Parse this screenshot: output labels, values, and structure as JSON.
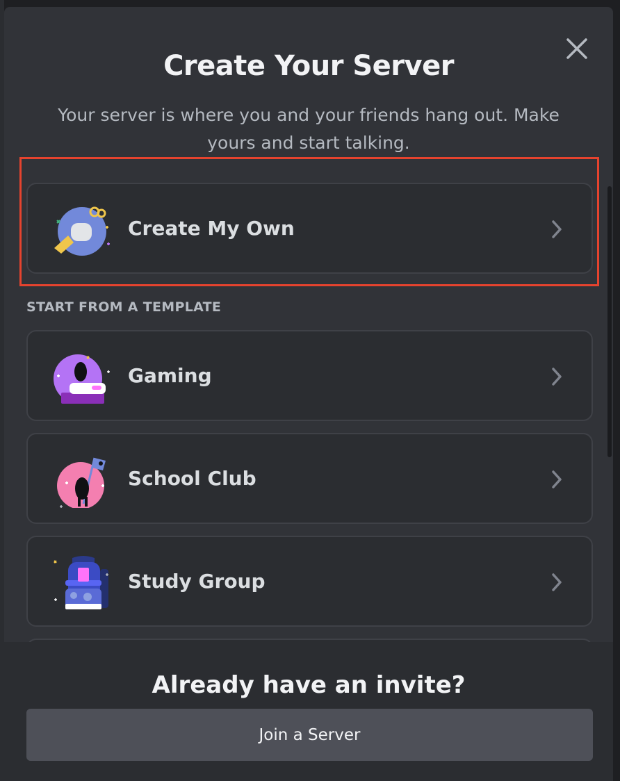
{
  "modal": {
    "title": "Create Your Server",
    "subtitle": "Your server is where you and your friends hang out. Make yours and start talking.",
    "close_icon": "close-icon"
  },
  "create_own": {
    "label": "Create My Own",
    "icon": "create-server-illustration-icon"
  },
  "templates": {
    "section_title": "START FROM A TEMPLATE",
    "items": [
      {
        "label": "Gaming",
        "icon": "gaming-illustration-icon"
      },
      {
        "label": "School Club",
        "icon": "school-club-illustration-icon"
      },
      {
        "label": "Study Group",
        "icon": "study-group-illustration-icon"
      }
    ]
  },
  "footer": {
    "title": "Already have an invite?",
    "join_label": "Join a Server"
  },
  "colors": {
    "background": "#313338",
    "card": "#2b2d31",
    "highlight_border": "#e5432e",
    "button": "#4e5058",
    "text_primary": "#f2f3f5"
  }
}
